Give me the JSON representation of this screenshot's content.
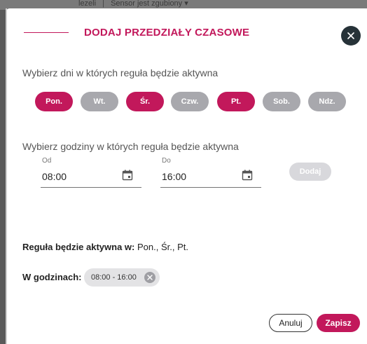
{
  "backdrop": {
    "left_text": "lezeli",
    "right_text": "Sensor jest zgubiony"
  },
  "dialog": {
    "title": "DODAJ PRZEDZIAŁY CZASOWE",
    "close_icon": "close-icon",
    "days_label": "Wybierz dni w których reguła będzie aktywna",
    "days": [
      {
        "label": "Pon.",
        "selected": true
      },
      {
        "label": "Wt.",
        "selected": false
      },
      {
        "label": "Śr.",
        "selected": true
      },
      {
        "label": "Czw.",
        "selected": false
      },
      {
        "label": "Pt.",
        "selected": true
      },
      {
        "label": "Sob.",
        "selected": false
      },
      {
        "label": "Ndz.",
        "selected": false
      }
    ],
    "hours_label": "Wybierz godziny w których reguła będzie aktywna",
    "from": {
      "label": "Od",
      "value": "08:00",
      "icon": "calendar-icon"
    },
    "to": {
      "label": "Do",
      "value": "16:00",
      "icon": "calendar-icon"
    },
    "add_label": "Dodaj",
    "summary_days_label": "Reguła będzie aktywna w:",
    "summary_days_value": "Pon., Śr., Pt.",
    "summary_hours_label": "W godzinach:",
    "hour_ranges": [
      "08:00 - 16:00"
    ],
    "cancel_label": "Anuluj",
    "save_label": "Zapisz"
  },
  "colors": {
    "accent": "#c2185b",
    "chip_inactive": "#a8a8ad",
    "close_bg": "#263238",
    "add_disabled": "#d8d8dc"
  }
}
